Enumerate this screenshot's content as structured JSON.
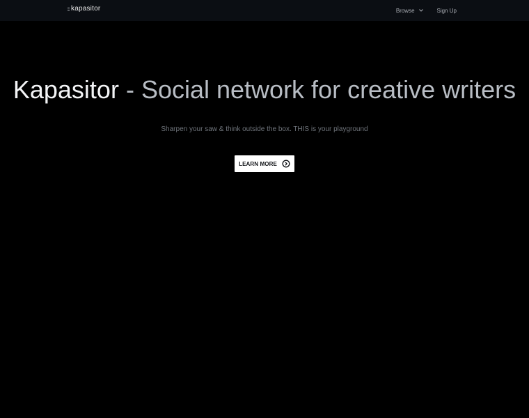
{
  "navbar": {
    "brand": "kapasitor",
    "links": [
      {
        "label": "Browse"
      },
      {
        "label": "Sign Up"
      }
    ]
  },
  "hero": {
    "title_brand": "Kapasitor",
    "title_rest": " - Social network for creative writers",
    "subtitle": "Sharpen your saw & think outside the box. THIS is your playground",
    "cta_label": "LEARN MORE"
  },
  "icons": {
    "brand": "brand-mark-icon",
    "browse": "chevron-down-icon",
    "cta": "arrow-circle-right-icon"
  },
  "colors": {
    "background": "#000000",
    "navbar": "#0b0e13",
    "cta_background": "#ffffff"
  }
}
